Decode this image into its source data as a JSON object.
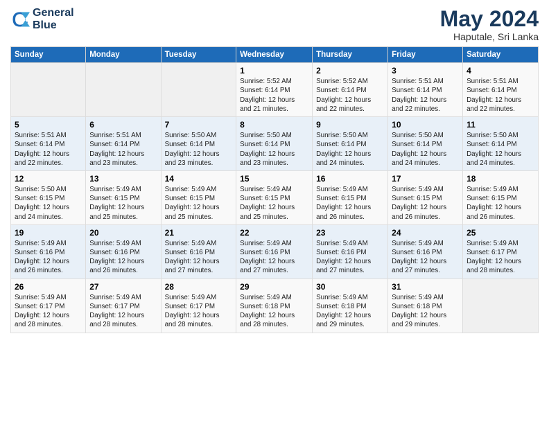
{
  "logo": {
    "line1": "General",
    "line2": "Blue"
  },
  "title": "May 2024",
  "subtitle": "Haputale, Sri Lanka",
  "days_header": [
    "Sunday",
    "Monday",
    "Tuesday",
    "Wednesday",
    "Thursday",
    "Friday",
    "Saturday"
  ],
  "weeks": [
    [
      {
        "day": "",
        "info": ""
      },
      {
        "day": "",
        "info": ""
      },
      {
        "day": "",
        "info": ""
      },
      {
        "day": "1",
        "info": "Sunrise: 5:52 AM\nSunset: 6:14 PM\nDaylight: 12 hours\nand 21 minutes."
      },
      {
        "day": "2",
        "info": "Sunrise: 5:52 AM\nSunset: 6:14 PM\nDaylight: 12 hours\nand 22 minutes."
      },
      {
        "day": "3",
        "info": "Sunrise: 5:51 AM\nSunset: 6:14 PM\nDaylight: 12 hours\nand 22 minutes."
      },
      {
        "day": "4",
        "info": "Sunrise: 5:51 AM\nSunset: 6:14 PM\nDaylight: 12 hours\nand 22 minutes."
      }
    ],
    [
      {
        "day": "5",
        "info": "Sunrise: 5:51 AM\nSunset: 6:14 PM\nDaylight: 12 hours\nand 22 minutes."
      },
      {
        "day": "6",
        "info": "Sunrise: 5:51 AM\nSunset: 6:14 PM\nDaylight: 12 hours\nand 23 minutes."
      },
      {
        "day": "7",
        "info": "Sunrise: 5:50 AM\nSunset: 6:14 PM\nDaylight: 12 hours\nand 23 minutes."
      },
      {
        "day": "8",
        "info": "Sunrise: 5:50 AM\nSunset: 6:14 PM\nDaylight: 12 hours\nand 23 minutes."
      },
      {
        "day": "9",
        "info": "Sunrise: 5:50 AM\nSunset: 6:14 PM\nDaylight: 12 hours\nand 24 minutes."
      },
      {
        "day": "10",
        "info": "Sunrise: 5:50 AM\nSunset: 6:14 PM\nDaylight: 12 hours\nand 24 minutes."
      },
      {
        "day": "11",
        "info": "Sunrise: 5:50 AM\nSunset: 6:14 PM\nDaylight: 12 hours\nand 24 minutes."
      }
    ],
    [
      {
        "day": "12",
        "info": "Sunrise: 5:50 AM\nSunset: 6:15 PM\nDaylight: 12 hours\nand 24 minutes."
      },
      {
        "day": "13",
        "info": "Sunrise: 5:49 AM\nSunset: 6:15 PM\nDaylight: 12 hours\nand 25 minutes."
      },
      {
        "day": "14",
        "info": "Sunrise: 5:49 AM\nSunset: 6:15 PM\nDaylight: 12 hours\nand 25 minutes."
      },
      {
        "day": "15",
        "info": "Sunrise: 5:49 AM\nSunset: 6:15 PM\nDaylight: 12 hours\nand 25 minutes."
      },
      {
        "day": "16",
        "info": "Sunrise: 5:49 AM\nSunset: 6:15 PM\nDaylight: 12 hours\nand 26 minutes."
      },
      {
        "day": "17",
        "info": "Sunrise: 5:49 AM\nSunset: 6:15 PM\nDaylight: 12 hours\nand 26 minutes."
      },
      {
        "day": "18",
        "info": "Sunrise: 5:49 AM\nSunset: 6:15 PM\nDaylight: 12 hours\nand 26 minutes."
      }
    ],
    [
      {
        "day": "19",
        "info": "Sunrise: 5:49 AM\nSunset: 6:16 PM\nDaylight: 12 hours\nand 26 minutes."
      },
      {
        "day": "20",
        "info": "Sunrise: 5:49 AM\nSunset: 6:16 PM\nDaylight: 12 hours\nand 26 minutes."
      },
      {
        "day": "21",
        "info": "Sunrise: 5:49 AM\nSunset: 6:16 PM\nDaylight: 12 hours\nand 27 minutes."
      },
      {
        "day": "22",
        "info": "Sunrise: 5:49 AM\nSunset: 6:16 PM\nDaylight: 12 hours\nand 27 minutes."
      },
      {
        "day": "23",
        "info": "Sunrise: 5:49 AM\nSunset: 6:16 PM\nDaylight: 12 hours\nand 27 minutes."
      },
      {
        "day": "24",
        "info": "Sunrise: 5:49 AM\nSunset: 6:16 PM\nDaylight: 12 hours\nand 27 minutes."
      },
      {
        "day": "25",
        "info": "Sunrise: 5:49 AM\nSunset: 6:17 PM\nDaylight: 12 hours\nand 28 minutes."
      }
    ],
    [
      {
        "day": "26",
        "info": "Sunrise: 5:49 AM\nSunset: 6:17 PM\nDaylight: 12 hours\nand 28 minutes."
      },
      {
        "day": "27",
        "info": "Sunrise: 5:49 AM\nSunset: 6:17 PM\nDaylight: 12 hours\nand 28 minutes."
      },
      {
        "day": "28",
        "info": "Sunrise: 5:49 AM\nSunset: 6:17 PM\nDaylight: 12 hours\nand 28 minutes."
      },
      {
        "day": "29",
        "info": "Sunrise: 5:49 AM\nSunset: 6:18 PM\nDaylight: 12 hours\nand 28 minutes."
      },
      {
        "day": "30",
        "info": "Sunrise: 5:49 AM\nSunset: 6:18 PM\nDaylight: 12 hours\nand 29 minutes."
      },
      {
        "day": "31",
        "info": "Sunrise: 5:49 AM\nSunset: 6:18 PM\nDaylight: 12 hours\nand 29 minutes."
      },
      {
        "day": "",
        "info": ""
      }
    ]
  ]
}
